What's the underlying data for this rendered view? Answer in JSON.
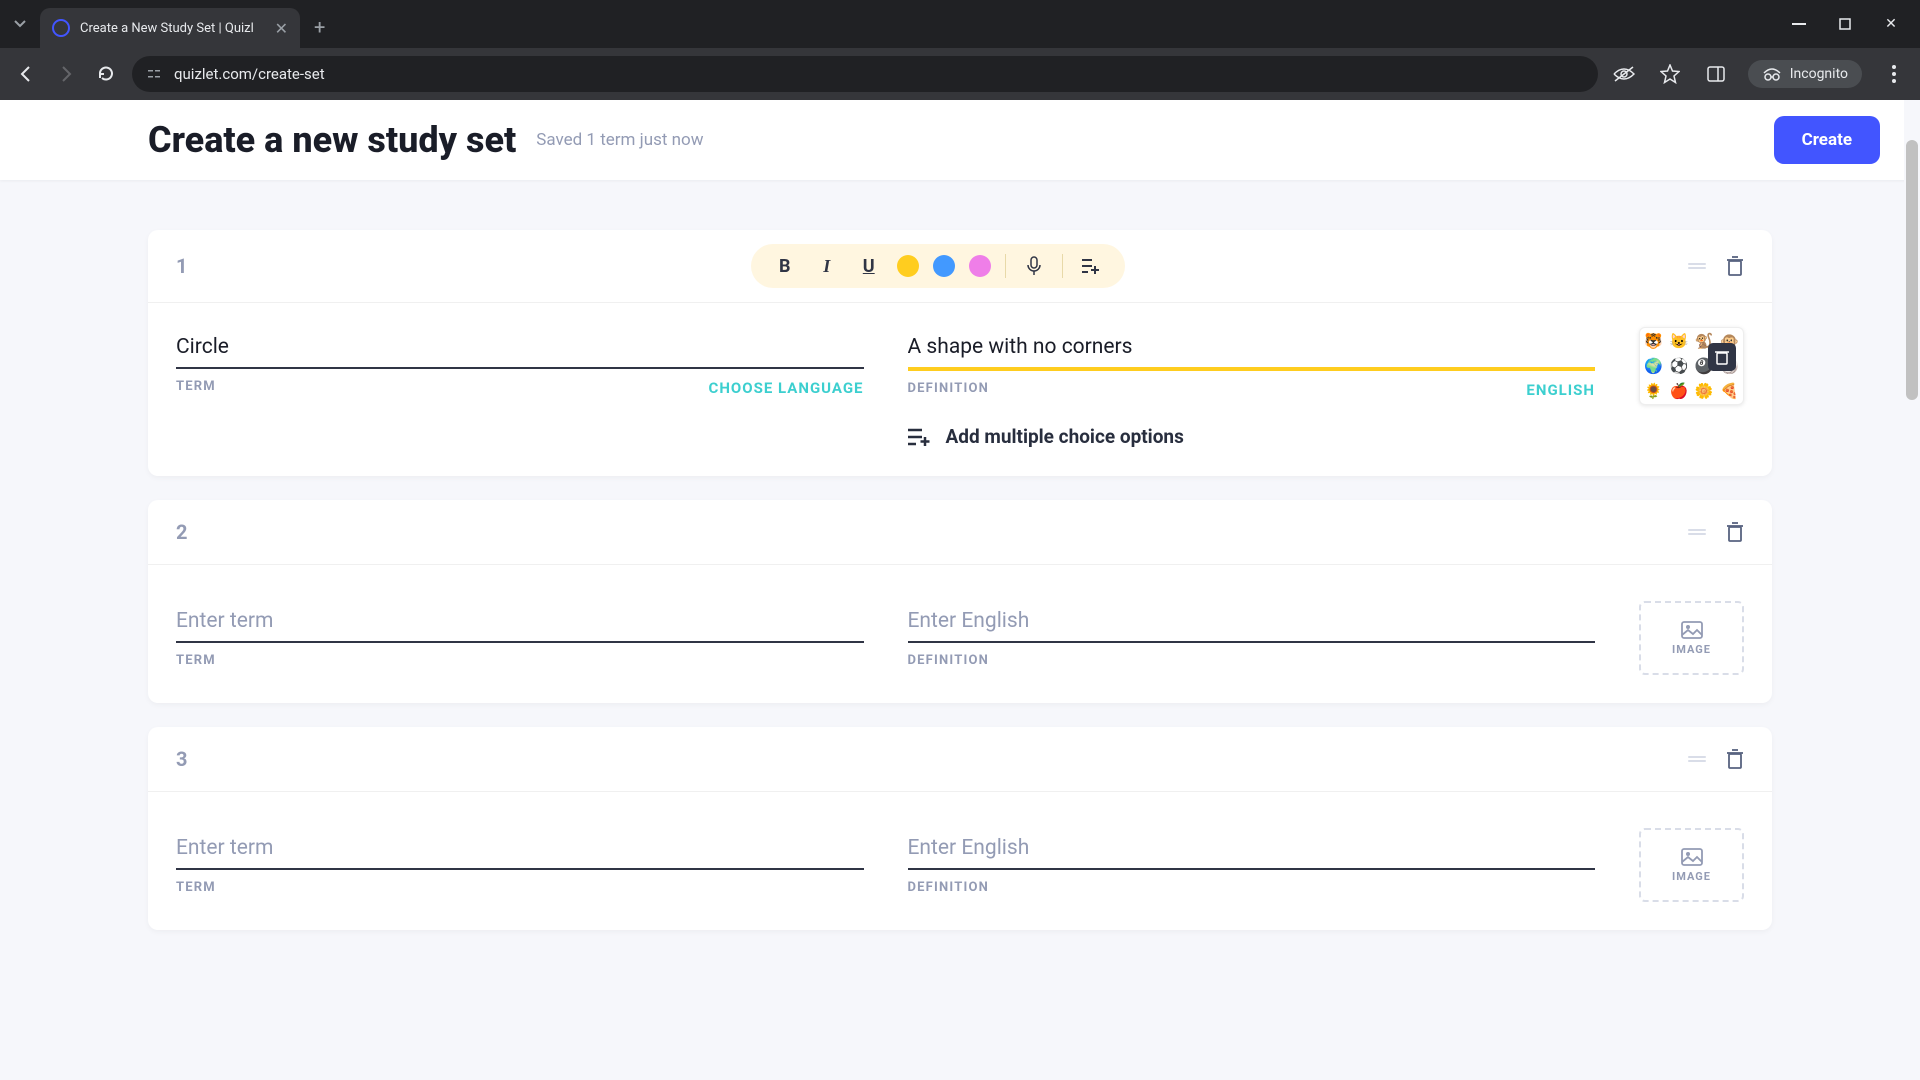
{
  "browser": {
    "tab_title": "Create a New Study Set | Quizl",
    "url": "quizlet.com/create-set",
    "incognito_label": "Incognito"
  },
  "header": {
    "title": "Create a new study set",
    "save_status": "Saved 1 term just now",
    "create_button": "Create"
  },
  "toolbar": {
    "bold": "B",
    "italic": "I",
    "underline": "U",
    "colors": {
      "yellow": "#ffcd1f",
      "blue": "#4299ff",
      "pink": "#ef7ee8"
    }
  },
  "labels": {
    "term": "TERM",
    "definition": "DEFINITION",
    "choose_language": "CHOOSE LANGUAGE",
    "english": "ENGLISH",
    "image": "IMAGE",
    "add_mc": "Add multiple choice options",
    "term_placeholder": "Enter term",
    "def_placeholder": "Enter English"
  },
  "cards": [
    {
      "num": "1",
      "term": "Circle",
      "definition": "A shape with no corners",
      "has_image": true,
      "active": true
    },
    {
      "num": "2",
      "term": "",
      "definition": "",
      "has_image": false,
      "active": false
    },
    {
      "num": "3",
      "term": "",
      "definition": "",
      "has_image": false,
      "active": false
    }
  ]
}
